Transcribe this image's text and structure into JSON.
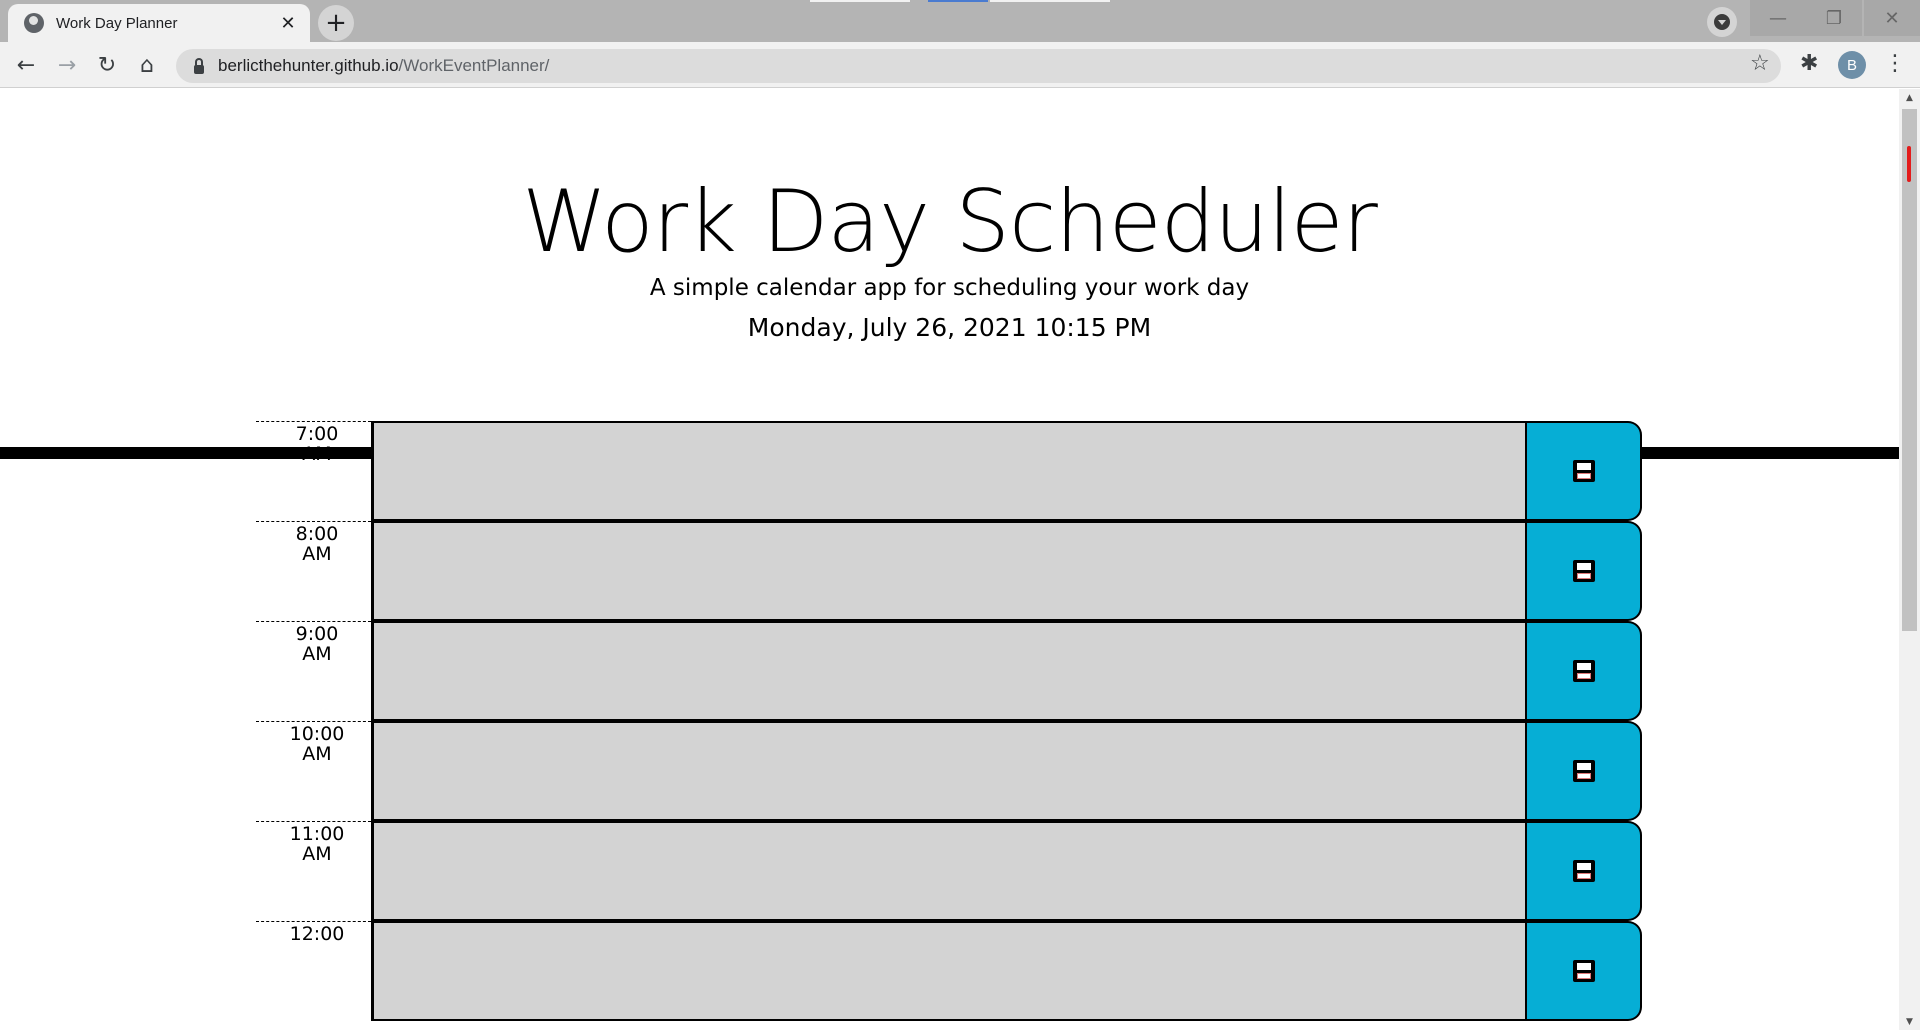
{
  "browser": {
    "tab_title": "Work Day Planner",
    "tab_close": "✕",
    "new_tab": "+",
    "url_host": "berlicthehunter.github.io",
    "url_path": "/WorkEventPlanner/",
    "profile_initial": "B"
  },
  "header": {
    "title": "Work Day Scheduler",
    "lead": "A simple calendar app for scheduling your work day",
    "current_day": "Monday, July 26, 2021 10:15 PM"
  },
  "timeblocks": [
    {
      "hour": "7:00 AM",
      "text": ""
    },
    {
      "hour": "8:00 AM",
      "text": ""
    },
    {
      "hour": "9:00 AM",
      "text": ""
    },
    {
      "hour": "10:00 AM",
      "text": ""
    },
    {
      "hour": "11:00 AM",
      "text": ""
    },
    {
      "hour": "12:00",
      "text": ""
    }
  ],
  "colors": {
    "past_block": "#d3d3d3",
    "save_button": "#06aed5",
    "chrome_tabstrip": "#b4b4b4",
    "chrome_toolbar": "#f1f1f1"
  },
  "icons": {
    "save": "floppy-disk-icon",
    "back": "arrow-left-icon",
    "forward": "arrow-right-icon",
    "reload": "reload-icon",
    "home": "home-icon",
    "bookmark": "star-icon",
    "extensions": "puzzle-icon",
    "menu": "kebab-icon"
  }
}
